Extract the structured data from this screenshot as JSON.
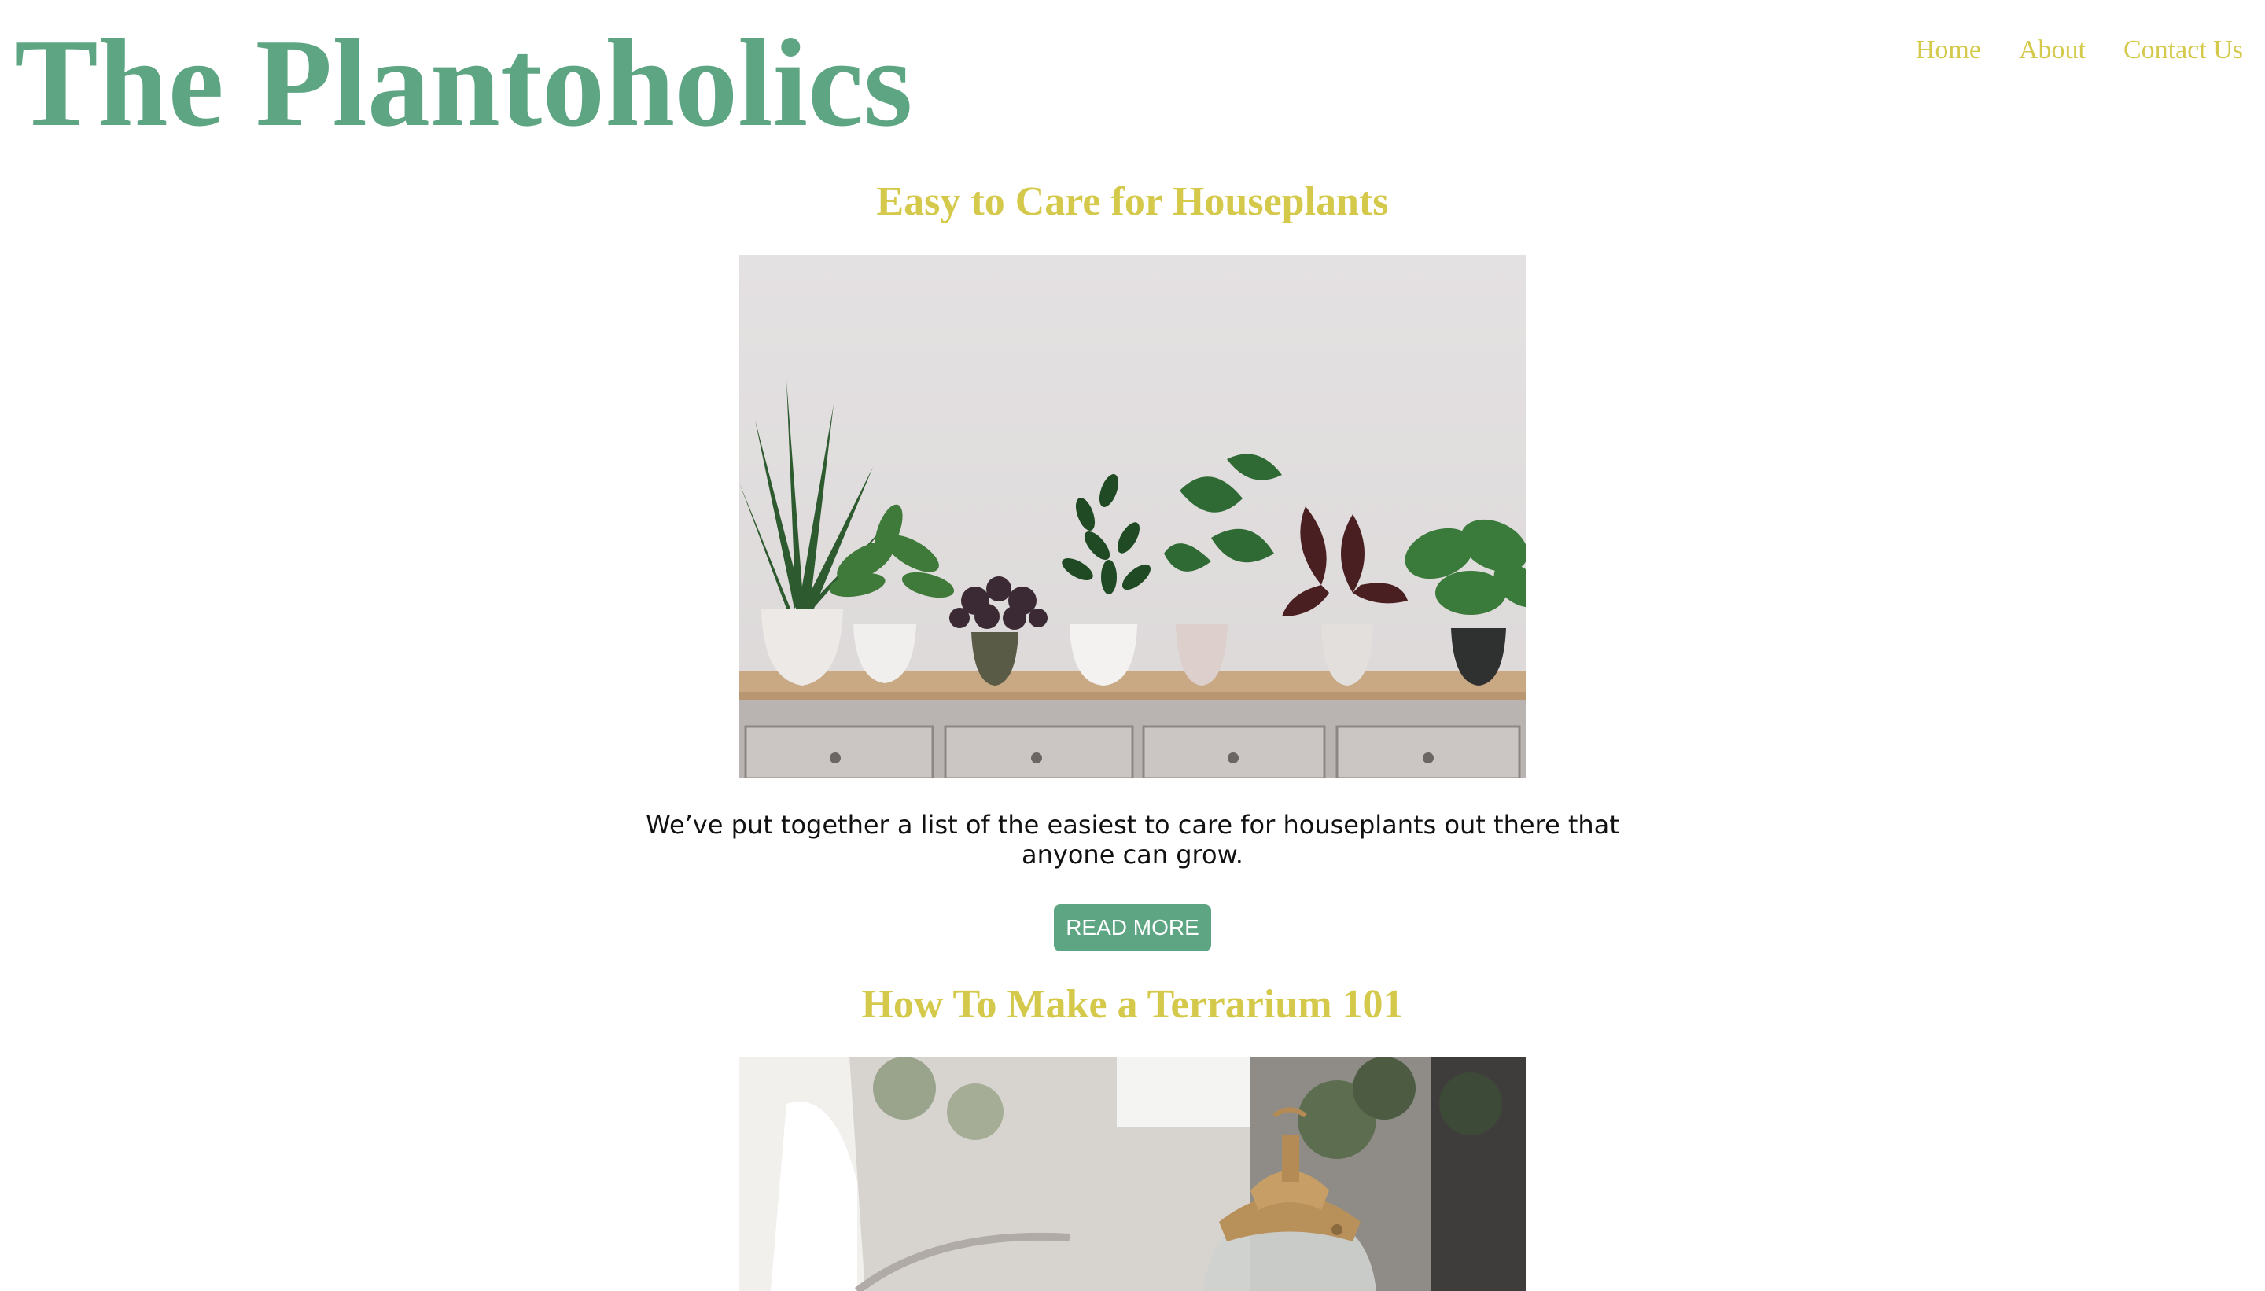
{
  "site": {
    "title": "The Plantoholics"
  },
  "nav": {
    "items": [
      {
        "label": "Home"
      },
      {
        "label": "About"
      },
      {
        "label": "Contact Us"
      }
    ]
  },
  "posts": [
    {
      "title": "Easy to Care for Houseplants",
      "image_alt": "Row of potted houseplants on a wooden dresser against a white wall",
      "excerpt": "We’ve put together a list of the easiest to care for houseplants out there that anyone can grow.",
      "button_label": "READ MORE"
    },
    {
      "title": "How To Make a Terrarium 101",
      "image_alt": "Glass terrarium with brass lid in a bright room"
    }
  ],
  "colors": {
    "brand_green": "#5ea584",
    "accent_yellow": "#d4c94a",
    "text": "#111111",
    "background": "#ffffff"
  }
}
